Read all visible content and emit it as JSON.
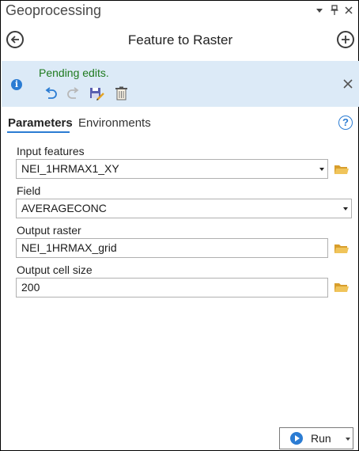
{
  "pane": {
    "title": "Geoprocessing",
    "controls": [
      "chevron-down-icon",
      "pin-icon",
      "close-icon"
    ]
  },
  "header": {
    "tool_title": "Feature to Raster",
    "back_icon": "arrow-left-circle-icon",
    "add_icon": "plus-circle-icon"
  },
  "infobar": {
    "message": "Pending edits.",
    "background": "#dceaf7",
    "message_color": "#1e7a1e",
    "icons": [
      "info-icon",
      "undo-icon",
      "redo-icon",
      "save-edits-icon",
      "discard-edits-icon",
      "close-icon"
    ]
  },
  "tabs": [
    {
      "label": "Parameters",
      "active": true
    },
    {
      "label": "Environments",
      "active": false
    }
  ],
  "parameters": [
    {
      "label": "Input features",
      "value": "NEI_1HRMAX1_XY",
      "type": "dropdown",
      "browse": true
    },
    {
      "label": "Field",
      "value": "AVERAGECONC",
      "type": "dropdown",
      "browse": false
    },
    {
      "label": "Output raster",
      "value": "NEI_1HRMAX_grid",
      "type": "text",
      "browse": true
    },
    {
      "label": "Output cell size",
      "value": "200",
      "type": "text",
      "browse": true
    }
  ],
  "run_button": {
    "label": "Run"
  },
  "colors": {
    "accent": "#2b7cd3",
    "folder": "#e8b64a"
  }
}
